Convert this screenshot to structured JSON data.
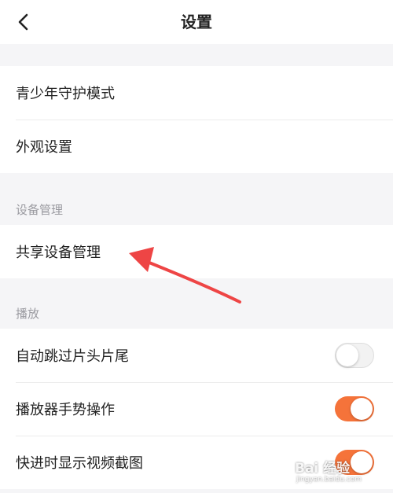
{
  "header": {
    "title": "设置",
    "back_icon": "chevron-left-icon"
  },
  "groups": {
    "general": {
      "items": [
        "青少年守护模式",
        "外观设置"
      ]
    },
    "device": {
      "section_label": "设备管理",
      "items": [
        "共享设备管理"
      ]
    },
    "playback": {
      "section_label": "播放",
      "items": [
        {
          "label": "自动跳过片头片尾",
          "toggle": "off"
        },
        {
          "label": "播放器手势操作",
          "toggle": "on"
        },
        {
          "label": "快进时显示视频截图",
          "toggle": "on"
        }
      ]
    }
  },
  "colors": {
    "accent": "#f5733a",
    "annotation_arrow": "#ee4545",
    "background": "#f5f5f7",
    "section_text": "#9a9aa0"
  },
  "watermark": {
    "main": "Bai 经验",
    "sub": "jingyan.baidu.com"
  }
}
